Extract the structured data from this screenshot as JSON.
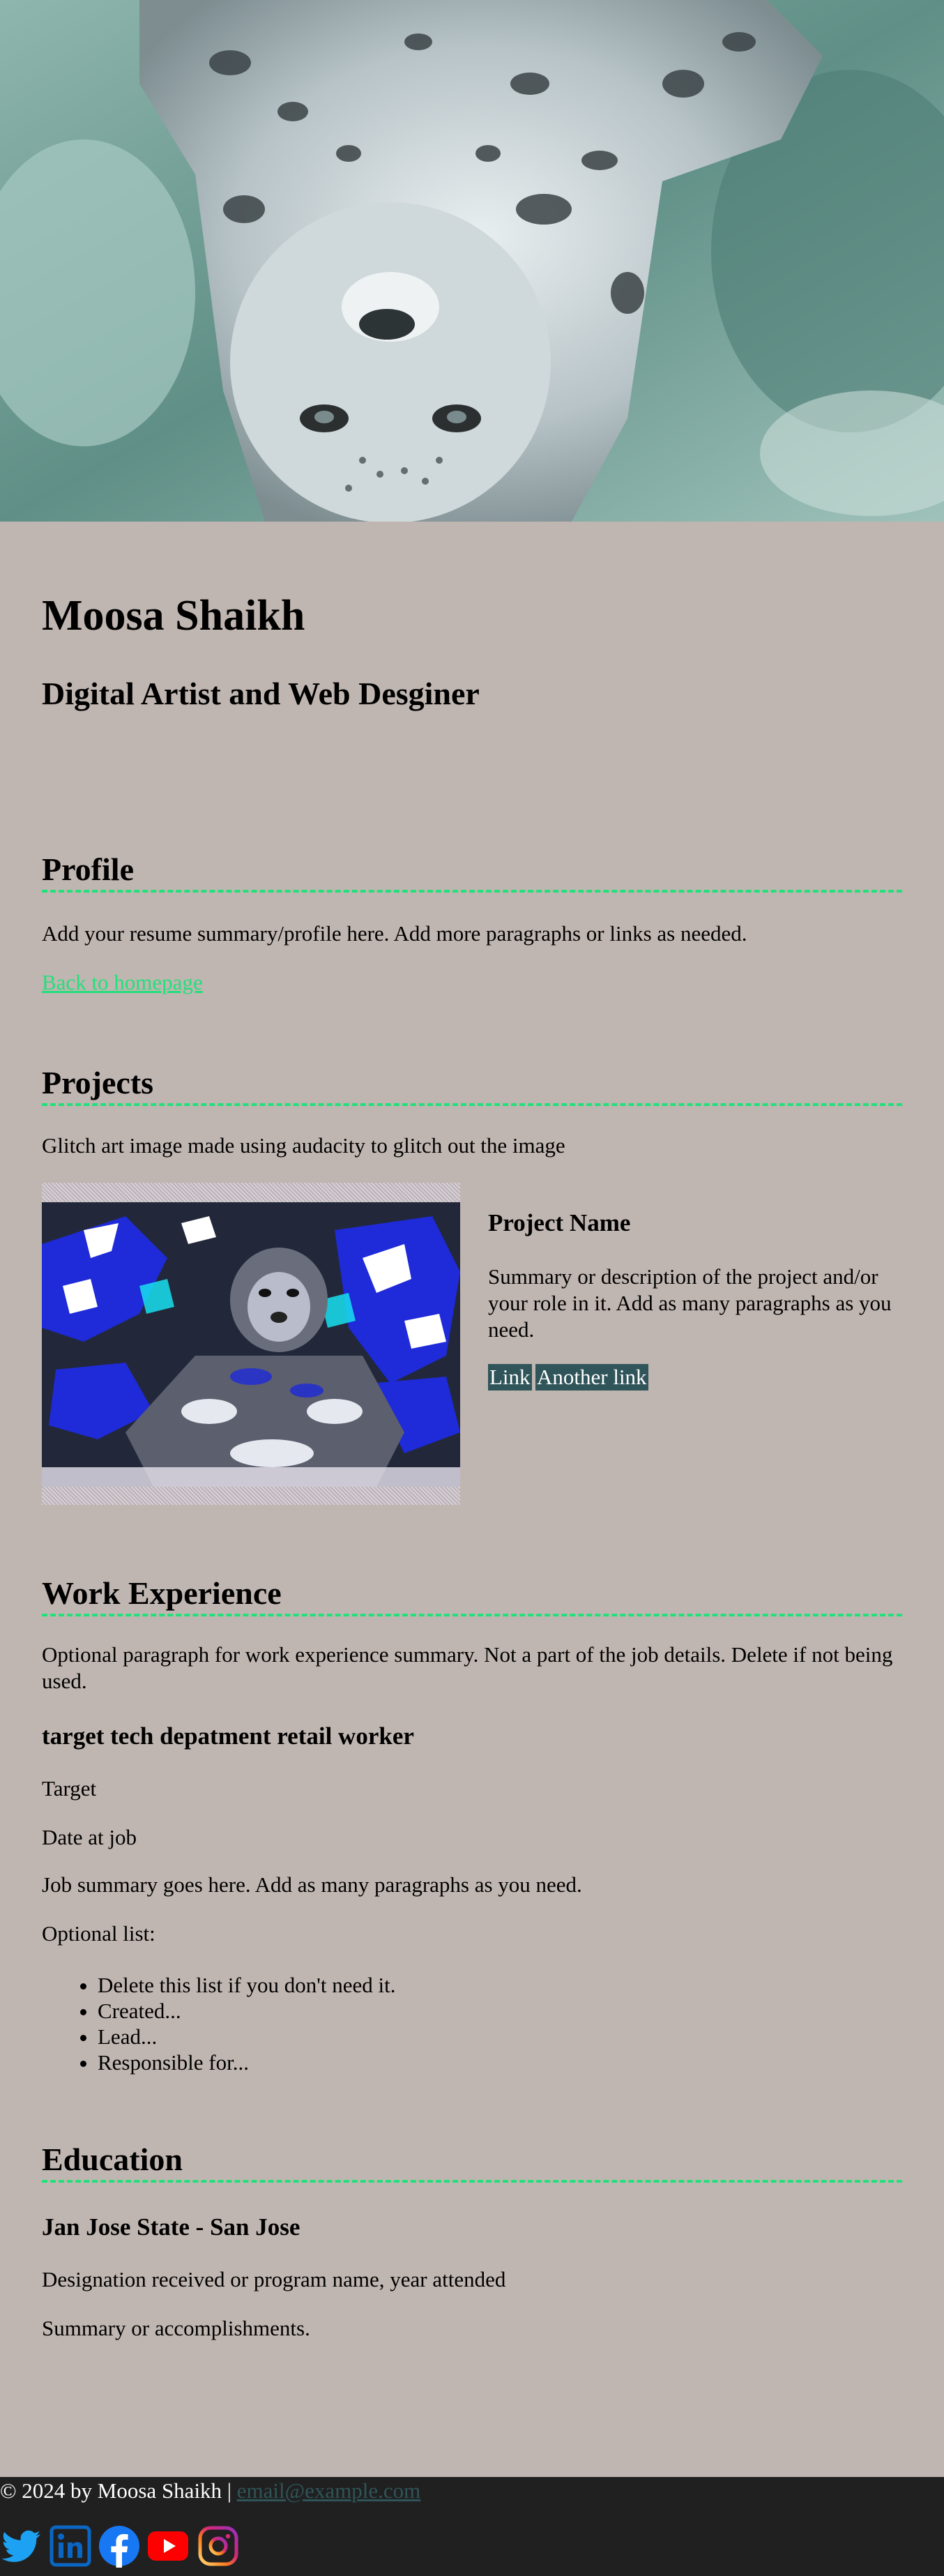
{
  "hero": {
    "icon": "snow-leopard-image"
  },
  "header": {
    "name": "Moosa Shaikh",
    "tagline": "Digital Artist and Web Desginer"
  },
  "profile": {
    "heading": "Profile",
    "summary": "Add your resume summary/profile here. Add more paragraphs or links as needed.",
    "back_link": "Back to homepage"
  },
  "projects": {
    "heading": "Projects",
    "intro": "Glitch art image made using audacity to glitch out the image",
    "image_icon": "glitch-art-snow-leopard",
    "name": "Project Name",
    "description": "Summary or description of the project and/or your role in it. Add as many paragraphs as you need.",
    "link1": "Link",
    "link2": "Another link"
  },
  "work": {
    "heading": "Work Experience",
    "summary": "Optional paragraph for work experience summary. Not a part of the job details. Delete if not being used.",
    "job_title": "target tech depatment retail worker",
    "company": "Target",
    "date": "Date at job",
    "job_summary": "Job summary goes here. Add as many paragraphs as you need.",
    "list_label": "Optional list:",
    "list": [
      "Delete this list if you don't need it.",
      "Created...",
      "Lead...",
      "Responsible for..."
    ]
  },
  "education": {
    "heading": "Education",
    "school": "Jan Jose State - San Jose",
    "program": "Designation received or program name, year attended",
    "summary": "Summary or accomplishments."
  },
  "footer": {
    "copyright": "© 2024 by Moosa Shaikh | ",
    "email": "email@example.com",
    "social": [
      "twitter-icon",
      "linkedin-icon",
      "facebook-icon",
      "youtube-icon",
      "instagram-icon"
    ]
  },
  "colors": {
    "background": "#c0b6b1",
    "accent_green": "#22e07a",
    "link_button": "#2f5459",
    "footer_bg": "#202020"
  }
}
